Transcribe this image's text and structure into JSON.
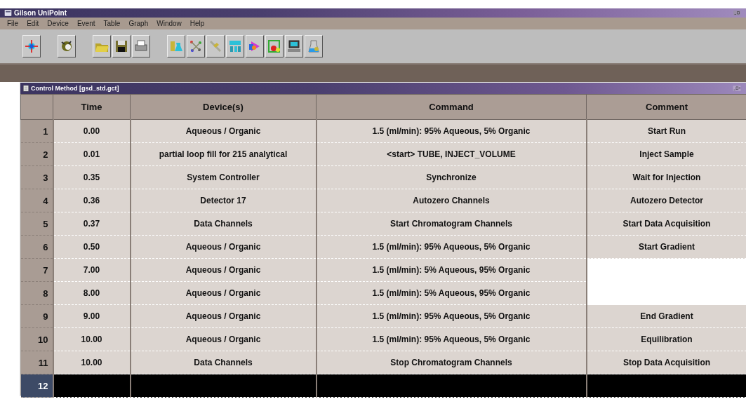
{
  "window": {
    "title": "Gilson UniPoint"
  },
  "menu": [
    "File",
    "Edit",
    "Device",
    "Event",
    "Table",
    "Graph",
    "Window",
    "Help"
  ],
  "method_window": {
    "title": "Control Method [gsd_std.gct]"
  },
  "table": {
    "columns": [
      "Time",
      "Device(s)",
      "Command",
      "Comment"
    ],
    "rows": [
      {
        "number": "1",
        "time": "0.00",
        "devices": "Aqueous / Organic",
        "command": "1.5 (ml/min): 95% Aqueous, 5% Organic",
        "comment": "Start Run",
        "selected": false
      },
      {
        "number": "2",
        "time": "0.01",
        "devices": "partial loop fill for 215 analytical",
        "command": "<start> TUBE, INJECT_VOLUME",
        "comment": "Inject Sample",
        "selected": false
      },
      {
        "number": "3",
        "time": "0.35",
        "devices": "System Controller",
        "command": "Synchronize",
        "comment": "Wait for Injection",
        "selected": false
      },
      {
        "number": "4",
        "time": "0.36",
        "devices": "Detector 17",
        "command": "Autozero Channels",
        "comment": "Autozero Detector",
        "selected": false
      },
      {
        "number": "5",
        "time": "0.37",
        "devices": "Data Channels",
        "command": "Start Chromatogram Channels",
        "comment": "Start Data Acquisition",
        "selected": false
      },
      {
        "number": "6",
        "time": "0.50",
        "devices": "Aqueous / Organic",
        "command": "1.5 (ml/min): 95% Aqueous, 5% Organic",
        "comment": "Start Gradient",
        "selected": false
      },
      {
        "number": "7",
        "time": "7.00",
        "devices": "Aqueous / Organic",
        "command": "1.5 (ml/min): 5% Aqueous, 95% Organic",
        "selected": false
      },
      {
        "number": "8",
        "time": "8.00",
        "devices": "Aqueous / Organic",
        "command": "1.5 (ml/min): 5% Aqueous, 95% Organic",
        "selected": false
      },
      {
        "number": "9",
        "time": "9.00",
        "devices": "Aqueous / Organic",
        "command": "1.5 (ml/min): 95% Aqueous, 5% Organic",
        "comment": "End Gradient",
        "selected": false
      },
      {
        "number": "10",
        "time": "10.00",
        "devices": "Aqueous / Organic",
        "command": "1.5 (ml/min): 95% Aqueous, 5% Organic",
        "comment": "Equilibration",
        "selected": false
      },
      {
        "number": "11",
        "time": "10.00",
        "devices": "Data Channels",
        "command": "Stop Chromatogram Channels",
        "comment": "Stop Data Acquisition",
        "selected": false
      },
      {
        "number": "12",
        "selected": true
      }
    ]
  }
}
